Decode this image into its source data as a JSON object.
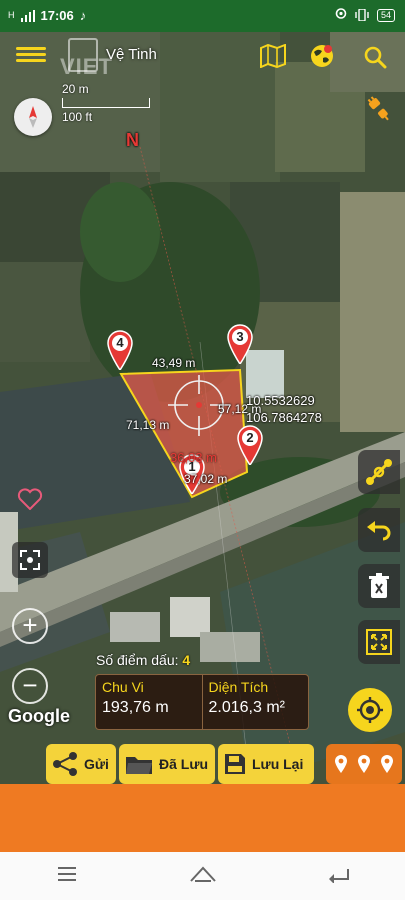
{
  "status_bar": {
    "time": "17:06",
    "signal": "H",
    "battery": "54"
  },
  "header": {
    "title": "Vệ Tinh",
    "watermark": "VIET",
    "scale_top": "20 m",
    "scale_bottom": "100 ft"
  },
  "compass": {
    "north_label": "N"
  },
  "measurement": {
    "edges": [
      "43,49 m",
      "71,13 m",
      "57,12 m",
      "37,02 m"
    ],
    "center_value": "36,03 m",
    "markers": [
      "1",
      "2",
      "3",
      "4"
    ],
    "coordinates": [
      "10.5532629",
      "106.7864278"
    ]
  },
  "info": {
    "point_count_label": "Số điểm dấu:",
    "point_count": "4",
    "perimeter_label": "Chu Vi",
    "perimeter_value": "193,76 m",
    "area_label": "Diện Tích",
    "area_value": "2.016,3  m²"
  },
  "branding": {
    "google": "Google"
  },
  "actions": {
    "send": "Gửi",
    "saved": "Đã Lưu",
    "save": "Lưu Lại"
  },
  "colors": {
    "accent": "#f6d51d",
    "polygon_fill": "#e05a4a",
    "marker": "#e53935",
    "action_bar": "#f4d33a",
    "pin_group": "#e6761d",
    "band": "#ef7a22",
    "status_bar": "#1d6b2b"
  }
}
